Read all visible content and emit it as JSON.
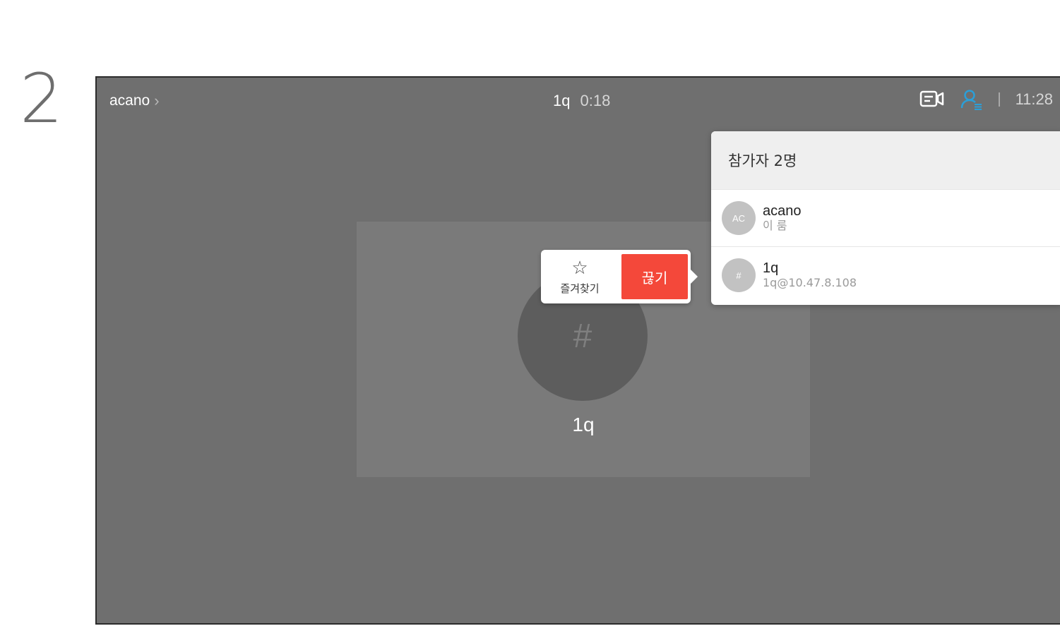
{
  "step_number": "2",
  "topbar": {
    "room_name": "acano",
    "call_name": "1q",
    "call_duration": "0:18",
    "clock": "11:28",
    "icons": [
      "camera-self-view-icon",
      "participants-icon"
    ],
    "accent_color": "#2b9fd8"
  },
  "tile": {
    "avatar_glyph": "#",
    "name": "1q"
  },
  "popover": {
    "favorite_label": "즐겨찾기",
    "end_label": "끊기",
    "end_color": "#f4483a"
  },
  "participants_panel": {
    "header": "참가자 2명",
    "items": [
      {
        "initials": "AC",
        "name": "acano",
        "sub": "이 룸"
      },
      {
        "initials": "#",
        "name": "1q",
        "sub": "1q@10.47.8.108"
      }
    ]
  }
}
